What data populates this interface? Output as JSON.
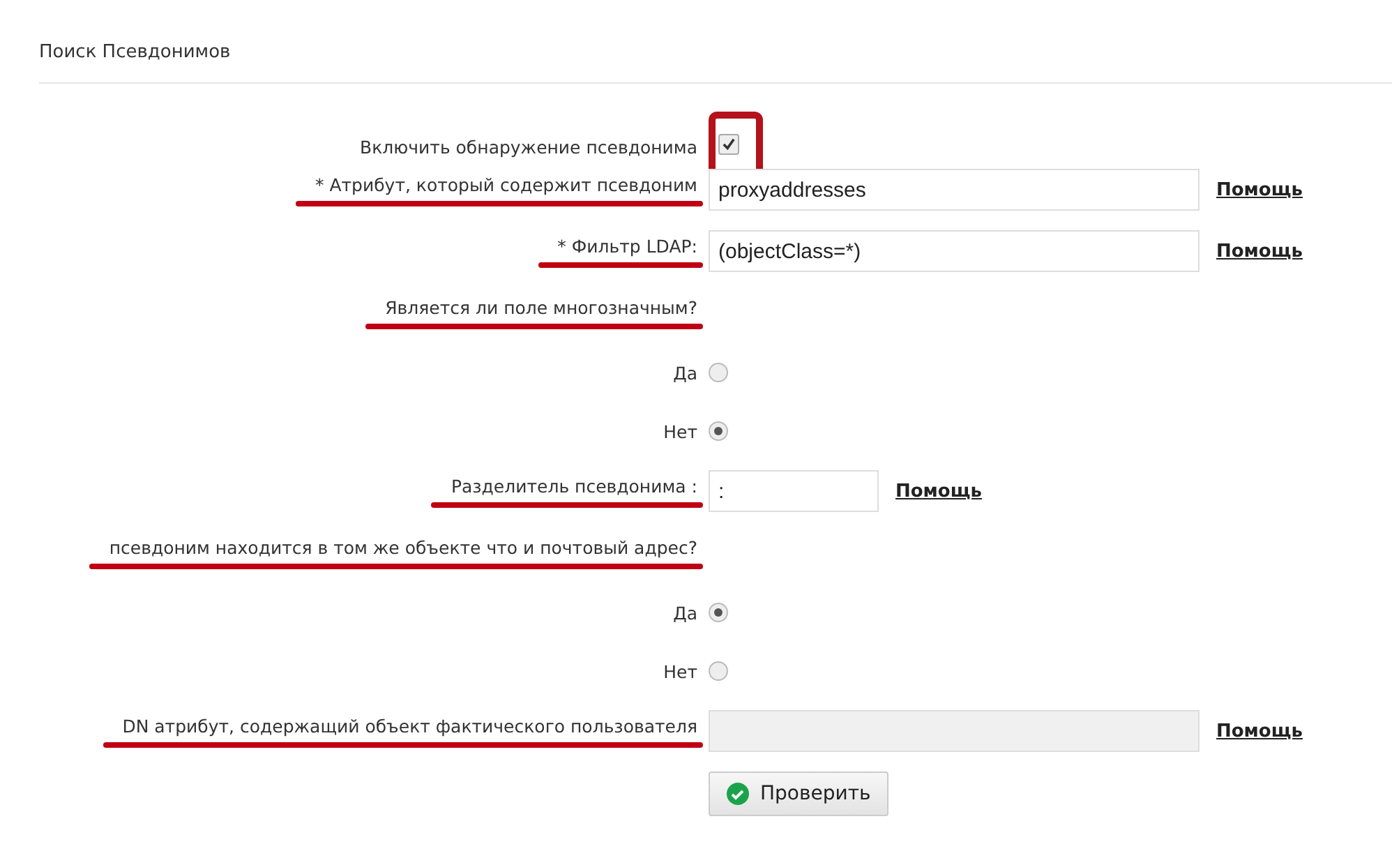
{
  "section_title": "Поиск Псевдонимов",
  "rows": [
    {
      "kind": "checkbox",
      "label": "Включить обнаружение псевдонима",
      "checked": true,
      "highlighted": true
    },
    {
      "kind": "text",
      "label": "* Атрибут, который содержит псевдоним",
      "value": "proxyaddresses",
      "help": "Помощь",
      "underlined": true,
      "disabled": false
    },
    {
      "kind": "text",
      "label": "* Фильтр LDAP:",
      "value": "(objectClass=*)",
      "help": "Помощь",
      "underlined": true,
      "disabled": false
    },
    {
      "kind": "question",
      "label": "Является ли поле многозначным?",
      "underlined": true
    },
    {
      "kind": "radio",
      "label": "Да",
      "selected": false
    },
    {
      "kind": "radio",
      "label": "Нет",
      "selected": true
    },
    {
      "kind": "short",
      "label": "Разделитель псевдонима :",
      "value": ":",
      "help": "Помощь",
      "underlined": true,
      "disabled": false
    },
    {
      "kind": "question",
      "label": "псевдоним находится в том же объекте что и почтовый адрес?",
      "underlined": true
    },
    {
      "kind": "radio",
      "label": "Да",
      "selected": true
    },
    {
      "kind": "radio",
      "label": "Нет",
      "selected": false
    },
    {
      "kind": "text",
      "label": "DN атрибут, содержащий объект фактического пользователя",
      "value": "",
      "help": "Помощь",
      "underlined": true,
      "disabled": true
    }
  ],
  "button": {
    "label": "Проверить"
  }
}
